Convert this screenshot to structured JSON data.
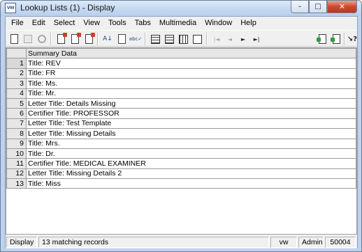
{
  "window": {
    "app_icon_text": "VW",
    "title": "Lookup Lists (1) - Display",
    "minimize_glyph": "–",
    "maximize_glyph": "□",
    "close_glyph": "✕"
  },
  "menu": [
    "File",
    "Edit",
    "Select",
    "View",
    "Tools",
    "Tabs",
    "Multimedia",
    "Window",
    "Help"
  ],
  "toolbar": {
    "icons": [
      "new-document-icon",
      "save-icon",
      "stop-icon",
      "print-icon",
      "print-preview-icon",
      "delete-icon",
      "sort-icon",
      "edit-icon",
      "spellcheck-icon",
      "form-view-icon",
      "table-view-icon",
      "summary-view-icon",
      "detail-view-icon",
      "first-record-icon",
      "previous-record-icon",
      "next-record-icon",
      "last-record-icon",
      "new-record-icon",
      "copy-record-icon",
      "context-help-icon"
    ],
    "sort_glyph": "A↓",
    "spell_glyph": "abc✓",
    "first_glyph": "|◄",
    "prev_glyph": "◄",
    "next_glyph": "►",
    "last_glyph": "►|",
    "help_glyph": "↘?"
  },
  "grid": {
    "column_header": "Summary Data",
    "rows": [
      {
        "num": "1",
        "text": "Title: REV"
      },
      {
        "num": "2",
        "text": "Title: FR"
      },
      {
        "num": "3",
        "text": "Title: Ms."
      },
      {
        "num": "4",
        "text": "Title: Mr."
      },
      {
        "num": "5",
        "text": "Letter Title: Details Missing"
      },
      {
        "num": "6",
        "text": "Certifier Title: PROFESSOR"
      },
      {
        "num": "7",
        "text": "Letter Title: Test Template"
      },
      {
        "num": "8",
        "text": "Letter Title: Missing Details"
      },
      {
        "num": "9",
        "text": "Title: Mrs."
      },
      {
        "num": "10",
        "text": "Title: Dr."
      },
      {
        "num": "11",
        "text": "Certifier Title: MEDICAL EXAMINER"
      },
      {
        "num": "12",
        "text": "Letter Title: Missing Details 2"
      },
      {
        "num": "13",
        "text": "Title: Miss"
      }
    ]
  },
  "status": {
    "mode": "Display",
    "records": "13 matching records",
    "code": "vw",
    "user": "Admin",
    "number": "50004"
  }
}
